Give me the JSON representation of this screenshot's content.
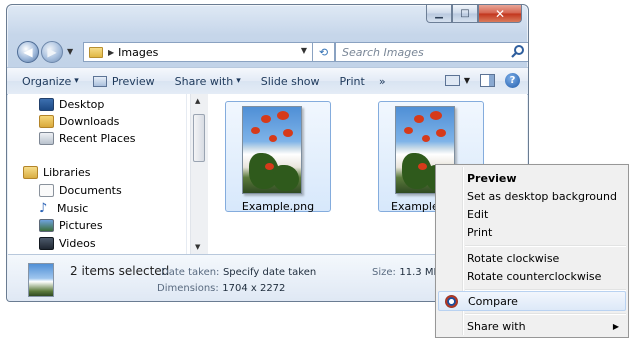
{
  "window": {
    "caption_buttons": {
      "minimize": "minimize-icon",
      "maximize": "maximize-icon",
      "close": "close-icon"
    }
  },
  "address": {
    "current": "Images",
    "search_placeholder": "Search Images"
  },
  "toolbar": {
    "organize": "Organize",
    "preview": "Preview",
    "share_with": "Share with",
    "slide_show": "Slide show",
    "print": "Print",
    "more": "»"
  },
  "nav": {
    "items": [
      {
        "label": "Desktop",
        "icon": "desktop-icon"
      },
      {
        "label": "Downloads",
        "icon": "downloads-icon"
      },
      {
        "label": "Recent Places",
        "icon": "recent-places-icon"
      },
      {
        "label": "Libraries",
        "icon": "libraries-icon"
      },
      {
        "label": "Documents",
        "icon": "documents-icon"
      },
      {
        "label": "Music",
        "icon": "music-icon"
      },
      {
        "label": "Pictures",
        "icon": "pictures-icon"
      },
      {
        "label": "Videos",
        "icon": "videos-icon"
      }
    ]
  },
  "files": [
    {
      "name": "Example.png"
    },
    {
      "name": "Example_Mo"
    }
  ],
  "details": {
    "count": "2 items selected",
    "date_taken_label": "Date taken:",
    "date_taken_value": "Specify date taken",
    "dimensions_label": "Dimensions:",
    "dimensions_value": "1704 x 2272",
    "size_label": "Size:",
    "size_value": "11.3 MB"
  },
  "context_menu": {
    "preview": "Preview",
    "set_desktop_bg": "Set as desktop background",
    "edit": "Edit",
    "print": "Print",
    "rotate_cw": "Rotate clockwise",
    "rotate_ccw": "Rotate counterclockwise",
    "compare": "Compare",
    "share_with": "Share with"
  },
  "colors": {
    "window_frame": "#c2d3e8",
    "selection_fill": "#d7e8fb",
    "selection_border": "#84acdd",
    "close_button": "#c2341c"
  }
}
